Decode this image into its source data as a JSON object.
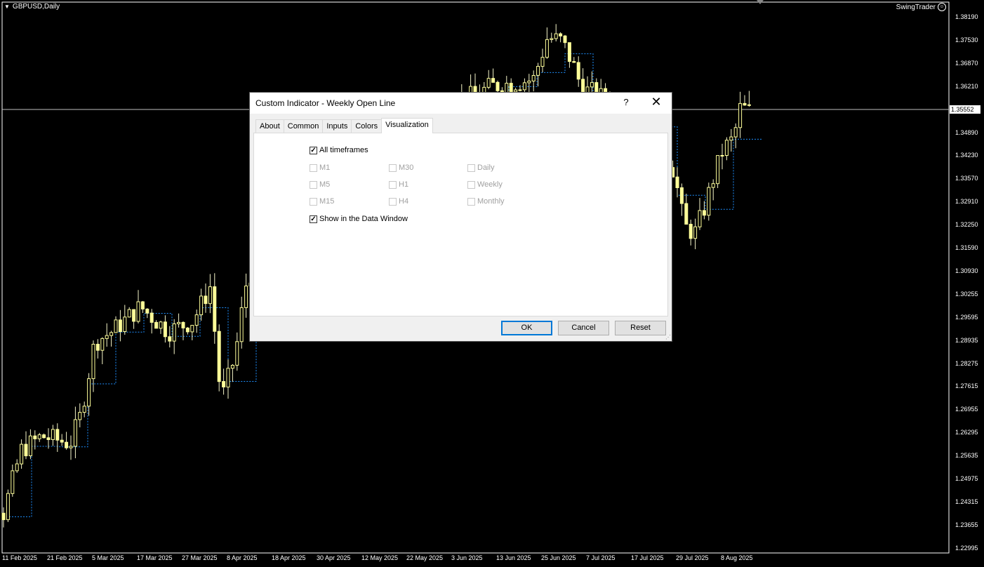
{
  "chart": {
    "symbol": "GBPUSD,Daily",
    "expert_label": "SwingTrader",
    "current_price": "1.35552",
    "price_ticks": [
      "1.38190",
      "1.37530",
      "1.36870",
      "1.36210",
      "1.35552",
      "1.34890",
      "1.34230",
      "1.33570",
      "1.32910",
      "1.32250",
      "1.31590",
      "1.30930",
      "1.30255",
      "1.29595",
      "1.28935",
      "1.28275",
      "1.27615",
      "1.26955",
      "1.26295",
      "1.25635",
      "1.24975",
      "1.24315",
      "1.23655",
      "1.22995"
    ],
    "date_ticks": [
      "11 Feb 2025",
      "21 Feb 2025",
      "5 Mar 2025",
      "17 Mar 2025",
      "27 Mar 2025",
      "8 Apr 2025",
      "18 Apr 2025",
      "30 Apr 2025",
      "12 May 2025",
      "22 May 2025",
      "3 Jun 2025",
      "13 Jun 2025",
      "25 Jun 2025",
      "7 Jul 2025",
      "17 Jul 2025",
      "29 Jul 2025",
      "8 Aug 2025"
    ],
    "colors": {
      "background": "#000000",
      "candle": "#ffff99",
      "wick": "#f5f5c8",
      "weekly_open_line": "#1e90ff"
    }
  },
  "dialog": {
    "title": "Custom Indicator - Weekly Open Line",
    "help": "?",
    "close": "✕",
    "tabs": [
      "About",
      "Common",
      "Inputs",
      "Colors",
      "Visualization"
    ],
    "active_tab": "Visualization",
    "all_timeframes": {
      "label": "All timeframes",
      "checked": true
    },
    "timeframes": {
      "m1": "M1",
      "m5": "M5",
      "m15": "M15",
      "m30": "M30",
      "h1": "H1",
      "h4": "H4",
      "daily": "Daily",
      "weekly": "Weekly",
      "monthly": "Monthly"
    },
    "show_data_window": {
      "label": "Show in the Data Window",
      "checked": true
    },
    "buttons": {
      "ok": "OK",
      "cancel": "Cancel",
      "reset": "Reset"
    }
  }
}
